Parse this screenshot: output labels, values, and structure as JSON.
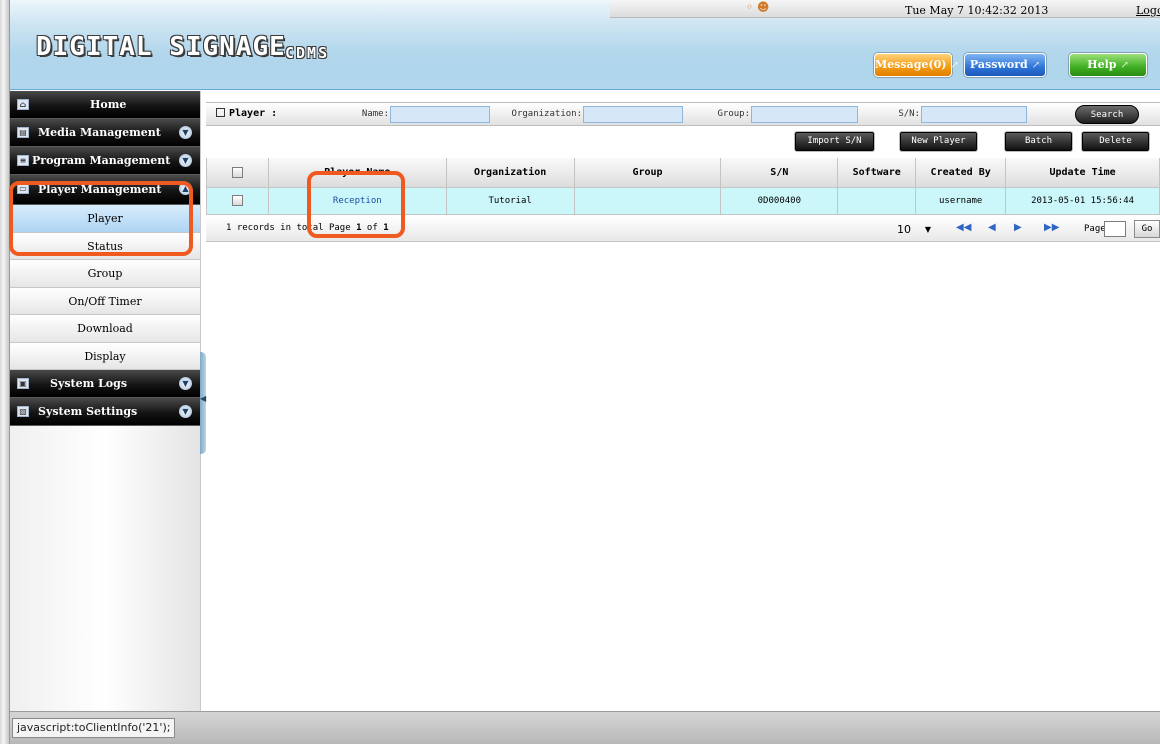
{
  "header": {
    "logo_main": "DIGITAL SIGNAGE",
    "logo_sub": "CDMS",
    "datetime": "Tue May 7 10:42:32 2013",
    "logout": "Logout",
    "buttons": {
      "message": "Message(0)",
      "password": "Password",
      "help": "Help"
    },
    "user_icon": "user-icon"
  },
  "sidebar": {
    "main_items": [
      {
        "label": "Home",
        "icon": "home-icon"
      },
      {
        "label": "Media Management",
        "icon": "media-icon"
      },
      {
        "label": "Program Management",
        "icon": "program-icon"
      },
      {
        "label": "Player Management",
        "icon": "player-icon"
      },
      {
        "label": "System Logs",
        "icon": "logs-icon"
      },
      {
        "label": "System Settings",
        "icon": "settings-icon"
      }
    ],
    "player_sub_items": [
      "Player",
      "Status",
      "Group",
      "On/Off Timer",
      "Download",
      "Display"
    ],
    "active_sub_item": "Player"
  },
  "search": {
    "section_title": "Player :",
    "name_label": "Name:",
    "organization_label": "Organization:",
    "group_label": "Group:",
    "sn_label": "S/N:",
    "name_value": "",
    "organization_value": "",
    "group_value": "",
    "sn_value": "",
    "search_button": "Search"
  },
  "actions": {
    "import_sn": "Import S/N",
    "new_player": "New Player",
    "batch": "Batch",
    "delete": "Delete"
  },
  "table": {
    "columns": [
      "",
      "Player Name",
      "Organization",
      "Group",
      "S/N",
      "Software",
      "Created By",
      "Update Time"
    ],
    "rows": [
      {
        "name": "Reception",
        "organization": "Tutorial",
        "group": "",
        "sn": "0D000400",
        "software": "",
        "created_by": "username",
        "update_time": "2013-05-01 15:56:44"
      }
    ]
  },
  "pager": {
    "prefix": "1 records in total",
    "page_label": "Page",
    "current_page": "1",
    "of_text": "of",
    "total_pages": "1",
    "page_size": "10",
    "page_word": "Page",
    "go": "Go"
  },
  "statusbar": {
    "text": "javascript:toClientInfo('21');"
  }
}
